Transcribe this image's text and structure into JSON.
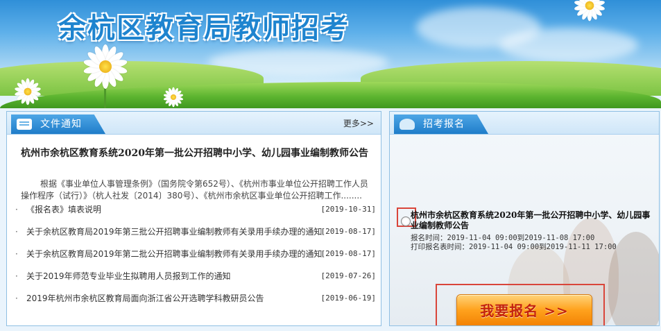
{
  "banner": {
    "title": "余杭区教育局教师招考"
  },
  "notices": {
    "header": "文件通知",
    "more": "更多>>",
    "featured": {
      "title": "杭州市余杭区教育系统2020年第一批公开招聘中小学、幼儿园事业编制教师公告",
      "summary": "根据《事业单位人事管理条例》（国务院令第652号）、《杭州市事业单位公开招聘工作人员操作程序（试行）》（杭人社发〔2014〕380号）、《杭州市余杭区事业单位公开招聘工作........"
    },
    "items": [
      {
        "bullet": "·",
        "title": "《报名表》填表说明",
        "date": "[2019-10-31]"
      },
      {
        "bullet": "·",
        "title": "关于余杭区教育局2019年第三批公开招聘事业编制教师有关录用手续办理的通知",
        "date": "[2019-08-17]"
      },
      {
        "bullet": "·",
        "title": "关于余杭区教育局2019年第二批公开招聘事业编制教师有关录用手续办理的通知",
        "date": "[2019-08-17]"
      },
      {
        "bullet": "·",
        "title": "关于2019年师范专业毕业生拟聘用人员报到工作的通知",
        "date": "[2019-07-26]"
      },
      {
        "bullet": "·",
        "title": "2019年杭州市余杭区教育局面向浙江省公开选聘学科教研员公告",
        "date": "[2019-06-19]"
      }
    ]
  },
  "registration": {
    "header": "招考报名",
    "exam_title": "杭州市余杭区教育系统2020年第一批公开招聘中小学、幼儿园事业编制教师公告",
    "reg_time": "报名时间：2019-11-04 09:00到2019-11-08 17:00",
    "print_time": "打印报名表时间：2019-11-04 09:00到2019-11-11 17:00",
    "button": "我要报名 >>"
  },
  "colors": {
    "accent": "#1f7dc9",
    "highlight_box": "#d9453a",
    "button": "#ffa21d"
  }
}
